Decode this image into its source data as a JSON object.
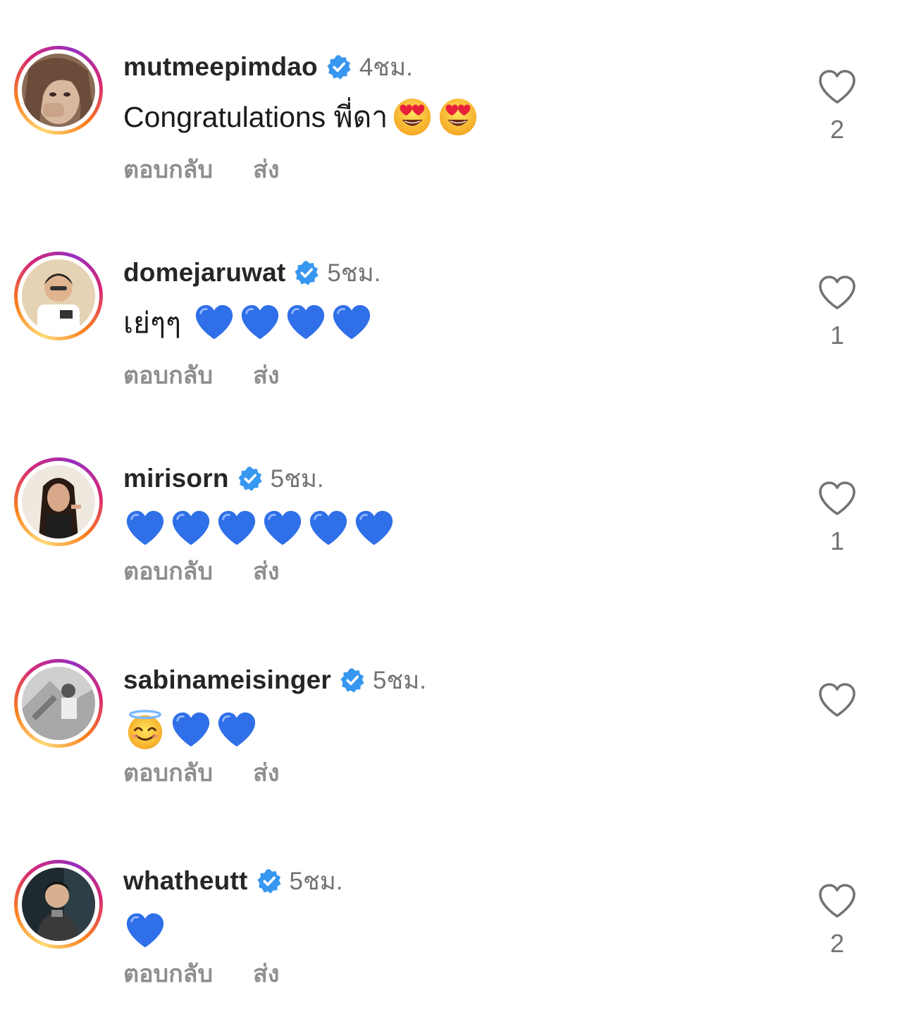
{
  "icons": {
    "verified": "verified-badge-icon",
    "like": "heart-outline-icon",
    "blue_heart": "blue-heart-emoji",
    "heart_eyes": "heart-eyes-emoji",
    "halo": "smiling-face-with-halo-emoji"
  },
  "colors": {
    "verified_blue": "#3897f0",
    "emoji_blue_heart": "#2f6fe8",
    "username": "#262626",
    "secondary_text": "#737373",
    "action_text": "#8e8e8e"
  },
  "comments": [
    {
      "username": "mutmeepimdao",
      "time": "4ชม.",
      "text": "Congratulations พี่ดา",
      "emojis": [
        "heart_eyes",
        "heart_eyes"
      ],
      "reply_label": "ตอบกลับ",
      "send_label": "ส่ง",
      "like_count": "2"
    },
    {
      "username": "domejaruwat",
      "time": "5ชม.",
      "text": "เย่ๆๆ",
      "emojis": [
        "blue_heart",
        "blue_heart",
        "blue_heart",
        "blue_heart"
      ],
      "reply_label": "ตอบกลับ",
      "send_label": "ส่ง",
      "like_count": "1"
    },
    {
      "username": "mirisorn",
      "time": "5ชม.",
      "text": "",
      "emojis": [
        "blue_heart",
        "blue_heart",
        "blue_heart",
        "blue_heart",
        "blue_heart",
        "blue_heart"
      ],
      "reply_label": "ตอบกลับ",
      "send_label": "ส่ง",
      "like_count": "1"
    },
    {
      "username": "sabinameisinger",
      "time": "5ชม.",
      "text": "",
      "emojis": [
        "halo",
        "blue_heart",
        "blue_heart"
      ],
      "reply_label": "ตอบกลับ",
      "send_label": "ส่ง",
      "like_count": ""
    },
    {
      "username": "whatheutt",
      "time": "5ชม.",
      "text": "",
      "emojis": [
        "blue_heart"
      ],
      "reply_label": "ตอบกลับ",
      "send_label": "ส่ง",
      "like_count": "2"
    }
  ]
}
